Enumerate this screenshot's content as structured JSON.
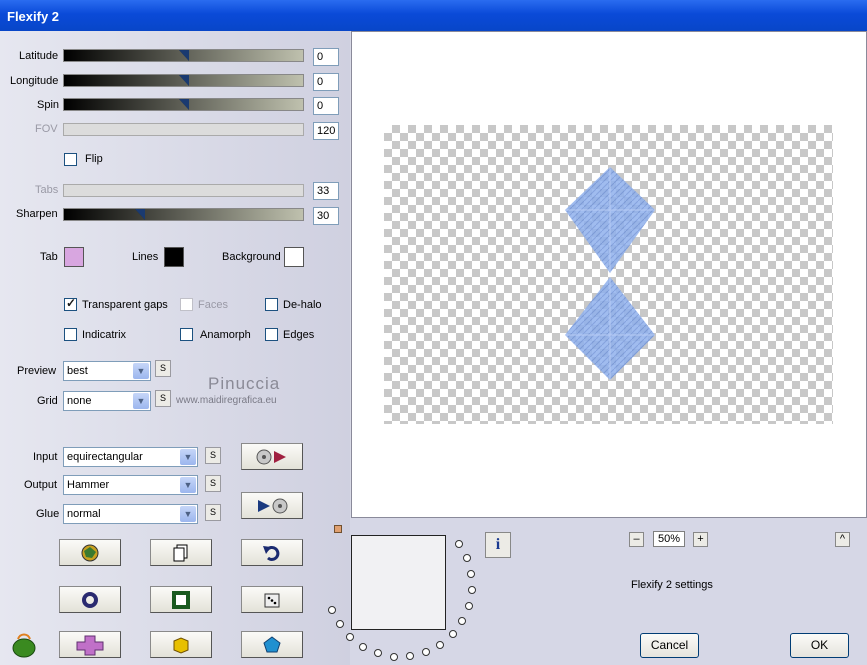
{
  "window": {
    "title": "Flexify 2"
  },
  "sliders": {
    "latitude": {
      "label": "Latitude",
      "value": "0"
    },
    "longitude": {
      "label": "Longitude",
      "value": "0"
    },
    "spin": {
      "label": "Spin",
      "value": "0"
    },
    "fov": {
      "label": "FOV",
      "value": "120"
    },
    "tabs": {
      "label": "Tabs",
      "value": "33"
    },
    "sharpen": {
      "label": "Sharpen",
      "value": "30"
    }
  },
  "flip": {
    "label": "Flip"
  },
  "colors": {
    "tab": {
      "label": "Tab",
      "color": "#d8a6e0"
    },
    "lines": {
      "label": "Lines",
      "color": "#000000"
    },
    "background": {
      "label": "Background",
      "color": "#ffffff"
    }
  },
  "checkboxes": {
    "transparent_gaps": {
      "label": "Transparent gaps",
      "checked": true
    },
    "faces": {
      "label": "Faces",
      "checked": false
    },
    "de_halo": {
      "label": "De-halo",
      "checked": false
    },
    "indicatrix": {
      "label": "Indicatrix",
      "checked": false
    },
    "anamorph": {
      "label": "Anamorph",
      "checked": false
    },
    "edges": {
      "label": "Edges",
      "checked": false
    }
  },
  "selects": {
    "preview": {
      "label": "Preview",
      "value": "best"
    },
    "grid": {
      "label": "Grid",
      "value": "none"
    },
    "input": {
      "label": "Input",
      "value": "equirectangular"
    },
    "output": {
      "label": "Output",
      "value": "Hammer"
    },
    "glue": {
      "label": "Glue",
      "value": "normal"
    }
  },
  "s_label": "S",
  "watermark": {
    "name": "Pinuccia",
    "url": "www.maidiregrafica.eu"
  },
  "zoom": {
    "value": "50%",
    "minus": "–",
    "plus": "+"
  },
  "info_icon": "i",
  "up_label": "^",
  "settings_caption": "Flexify 2 settings",
  "dialog": {
    "cancel": "Cancel",
    "ok": "OK"
  }
}
